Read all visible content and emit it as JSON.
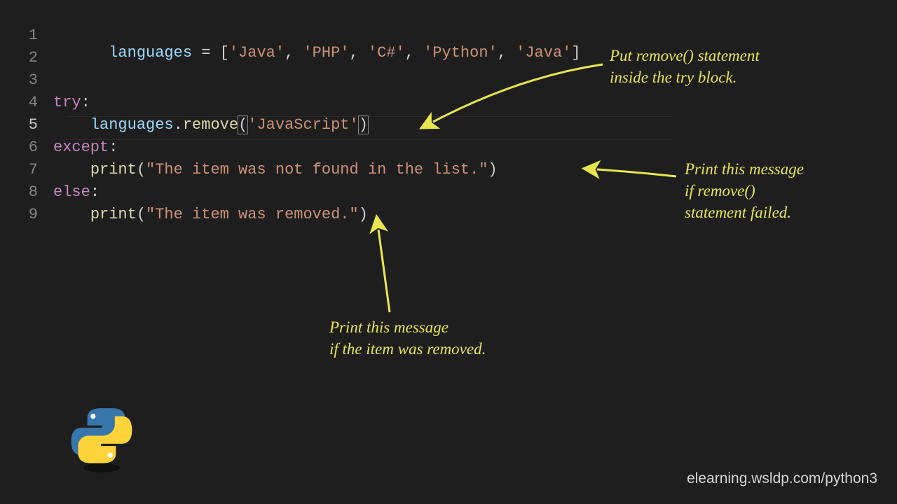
{
  "line_numbers": [
    "1",
    "2",
    "3",
    "4",
    "5",
    "6",
    "7",
    "8",
    "9"
  ],
  "code": {
    "l1": {
      "var": "languages",
      "eq": " = [",
      "s1": "'Java'",
      "c1": ", ",
      "s2": "'PHP'",
      "c2": ", ",
      "s3": "'C#'",
      "c3": ", ",
      "s4": "'Python'",
      "c4": ", ",
      "s5": "'Java'",
      "close": "]"
    },
    "l4": {
      "kw": "try",
      "colon": ":"
    },
    "l5": {
      "indent": "    ",
      "obj": "languages",
      "dot": ".",
      "fn": "remove",
      "open": "(",
      "arg": "'JavaScript'",
      "close": ")"
    },
    "l6": {
      "kw": "except",
      "colon": ":"
    },
    "l7": {
      "indent": "    ",
      "fn": "print",
      "open": "(",
      "arg": "\"The item was not found in the list.\"",
      "close": ")"
    },
    "l8": {
      "kw": "else",
      "colon": ":"
    },
    "l9": {
      "indent": "    ",
      "fn": "print",
      "open": "(",
      "arg": "\"The item was removed.\"",
      "close": ")"
    }
  },
  "annotations": {
    "a1_line1": "Put remove() statement",
    "a1_line2": "inside the try block.",
    "a2_line1": "Print this message",
    "a2_line2": "if remove()",
    "a2_line3": "statement failed.",
    "a3_line1": "Print this message",
    "a3_line2": "if the item was removed."
  },
  "credit": "elearning.wsldp.com/python3"
}
